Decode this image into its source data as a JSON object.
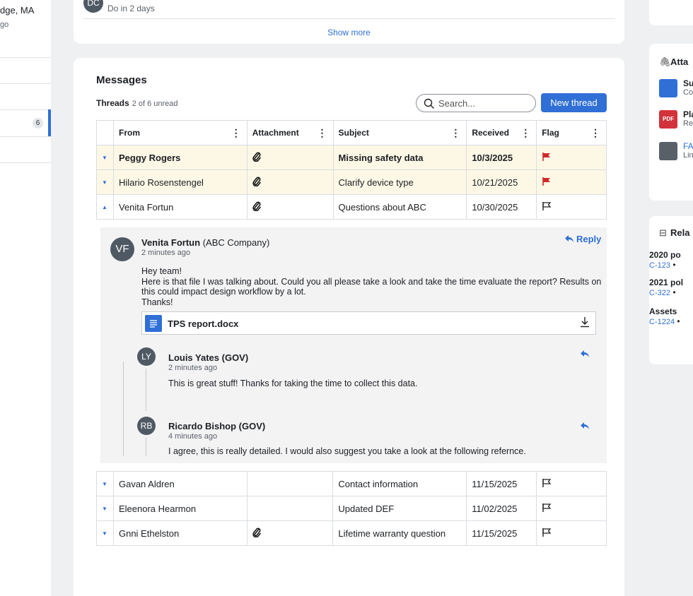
{
  "left": {
    "location": "dge, MA",
    "ago": "go",
    "badge": "6"
  },
  "top_card": {
    "avatar": "DC",
    "task_due": "Do in 2 days",
    "show_more": "Show more"
  },
  "messages": {
    "title": "Messages",
    "threads_label": "Threads",
    "unread": "2 of 6 unread",
    "search_placeholder": "Search...",
    "new_thread": "New thread",
    "columns": [
      "From",
      "Attachment",
      "Subject",
      "Received",
      "Flag"
    ],
    "rows_top": [
      {
        "from": "Peggy Rogers",
        "subject": "Missing safety data",
        "received": "10/3/2025",
        "attachment": true,
        "flag": "red"
      },
      {
        "from": "Hilario Rosenstengel",
        "subject": "Clarify device type",
        "received": "10/21/2025",
        "attachment": true,
        "flag": "red"
      },
      {
        "from": "Venita Fortun",
        "subject": "Questions about ABC",
        "received": "10/30/2025",
        "attachment": true,
        "flag": "outline"
      }
    ],
    "rows_bottom": [
      {
        "from": "Gavan Aldren",
        "subject": "Contact information",
        "received": "11/15/2025",
        "attachment": false,
        "flag": "outline"
      },
      {
        "from": "Eleenora Hearmon",
        "subject": "Updated DEF",
        "received": "11/02/2025",
        "attachment": false,
        "flag": "outline"
      },
      {
        "from": "Gnni Ethelston",
        "subject": "Lifetime warranty question",
        "received": "11/15/2025",
        "attachment": true,
        "flag": "outline"
      }
    ]
  },
  "thread": {
    "main": {
      "initials": "VF",
      "name": "Venita Fortun",
      "org": "(ABC Company)",
      "time": "2 minutes ago",
      "reply": "Reply",
      "lines": [
        "Hey team!",
        "Here is that file I was talking about. Could you all please take a look and take the time evaluate the report? Results on",
        "this could impact design workflow by a lot.",
        "Thanks!"
      ],
      "file": "TPS report.docx"
    },
    "replies": [
      {
        "initials": "LY",
        "name": "Louis Yates (GOV)",
        "time": "2 minutes ago",
        "text": "This is great stuff! Thanks for taking the time to collect this data."
      },
      {
        "initials": "RB",
        "name": "Ricardo Bishop (GOV)",
        "time": "4 minutes ago",
        "text": "I agree, this is really detailed. I would also suggest you take a look at the following refernce."
      }
    ]
  },
  "right": {
    "attachments_title": "Atta",
    "files": [
      {
        "icon": "",
        "name": "Su",
        "sub": "Co"
      },
      {
        "icon": "PDF",
        "name": "Pla",
        "sub": "Re"
      },
      {
        "icon": "",
        "name": "FA",
        "sub": "Lin"
      }
    ],
    "related_title": "Rela",
    "related": [
      {
        "name": "2020 po",
        "id": "C-123",
        "suffix": "•"
      },
      {
        "name": "2021 pol",
        "id": "C-322",
        "suffix": "•"
      },
      {
        "name": "Assets",
        "id": "C-1224",
        "suffix": "•"
      }
    ]
  }
}
